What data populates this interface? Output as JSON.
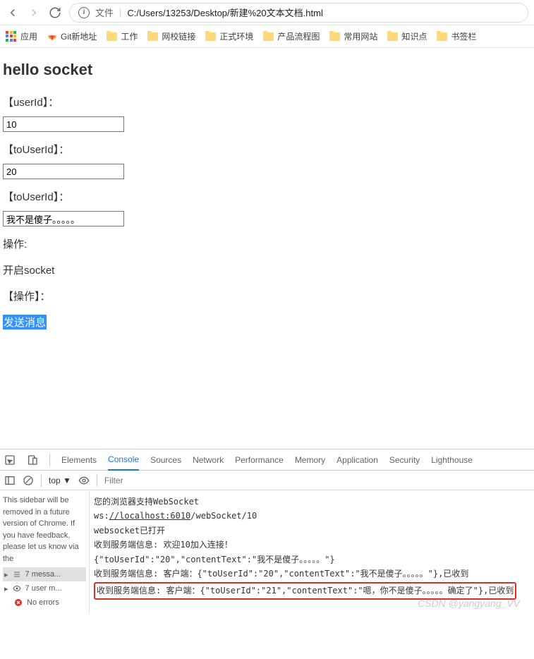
{
  "browser": {
    "address_prefix": "文件",
    "url": "C:/Users/13253/Desktop/新建%20文本文档.html"
  },
  "bookmarks": {
    "apps": "应用",
    "items": [
      "Git新地址",
      "工作",
      "网校链接",
      "正式环境",
      "产品流程图",
      "常用网站",
      "知识点",
      "书签栏"
    ]
  },
  "page": {
    "title": "hello socket",
    "label_userId": "【userId】：",
    "input_userId": "10",
    "label_toUserId": "【toUserId】：",
    "input_toUserId": "20",
    "label_toUserId2": "【toUserId】：",
    "input_message": "我不是傻子。。。。。",
    "op_label": "操作:",
    "op_open": "开启socket",
    "op_label2": "【操作】：",
    "send_btn": "发送消息"
  },
  "devtools": {
    "tabs": [
      "Elements",
      "Console",
      "Sources",
      "Network",
      "Performance",
      "Memory",
      "Application",
      "Security",
      "Lighthouse"
    ],
    "active_tab": "Console",
    "top_label": "top ▼",
    "filter_placeholder": "Filter",
    "sidebar_notice": "This sidebar will be removed in a future version of Chrome. If you have feedback, please let us know via the",
    "sb_items": [
      {
        "label": "7 messa...",
        "type": "list"
      },
      {
        "label": "7 user m...",
        "type": "eye"
      },
      {
        "label": "No errors",
        "type": "error"
      }
    ],
    "console": {
      "l1": "您的浏览器支持WebSocket",
      "l2_pre": "ws:",
      "l2_link": "//localhost:6010",
      "l2_post": "/webSocket/10",
      "l3": "websocket已打开",
      "l4": "收到服务端信息: 欢迎10加入连接！",
      "l5": "{\"toUserId\":\"20\",\"contentText\":\"我不是傻子。。。。。\"}",
      "l6": "收到服务端信息: 客户端：{\"toUserId\":\"20\",\"contentText\":\"我不是傻子。。。。。\"},已收到",
      "l7": "收到服务端信息: 客户端：{\"toUserId\":\"21\",\"contentText\":\"嗯，你不是傻子。。。。。确定了\"},已收到"
    }
  },
  "watermark": "CSDN @yangyang_VV"
}
